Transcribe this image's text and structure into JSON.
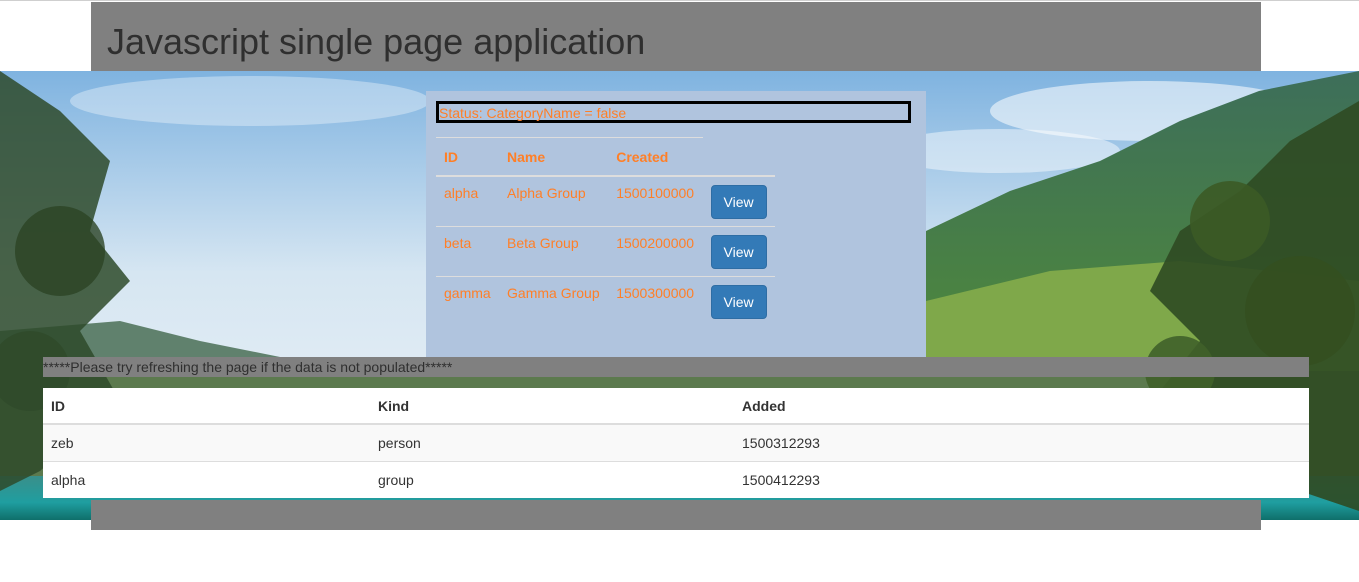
{
  "header": {
    "title": "Javascript single page application"
  },
  "category_panel": {
    "status_text": "Status: CategoryName = false",
    "columns": [
      "ID",
      "Name",
      "Created"
    ],
    "rows": [
      {
        "id": "alpha",
        "name": "Alpha Group",
        "created": "1500100000",
        "action": "View"
      },
      {
        "id": "beta",
        "name": "Beta Group",
        "created": "1500200000",
        "action": "View"
      },
      {
        "id": "gamma",
        "name": "Gamma Group",
        "created": "1500300000",
        "action": "View"
      }
    ]
  },
  "notice": {
    "text": "*****Please try refreshing the page if the data is not populated*****"
  },
  "entity_table": {
    "columns": [
      "ID",
      "Kind",
      "Added"
    ],
    "rows": [
      {
        "id": "zeb",
        "kind": "person",
        "added": "1500312293"
      },
      {
        "id": "alpha",
        "kind": "group",
        "added": "1500412293"
      }
    ]
  },
  "colors": {
    "header_band": "#808080",
    "panel_background": "#b0c4de",
    "accent_text": "#ff7f27",
    "button_primary": "#337ab7"
  },
  "background_image": "mountain-lake-landscape"
}
